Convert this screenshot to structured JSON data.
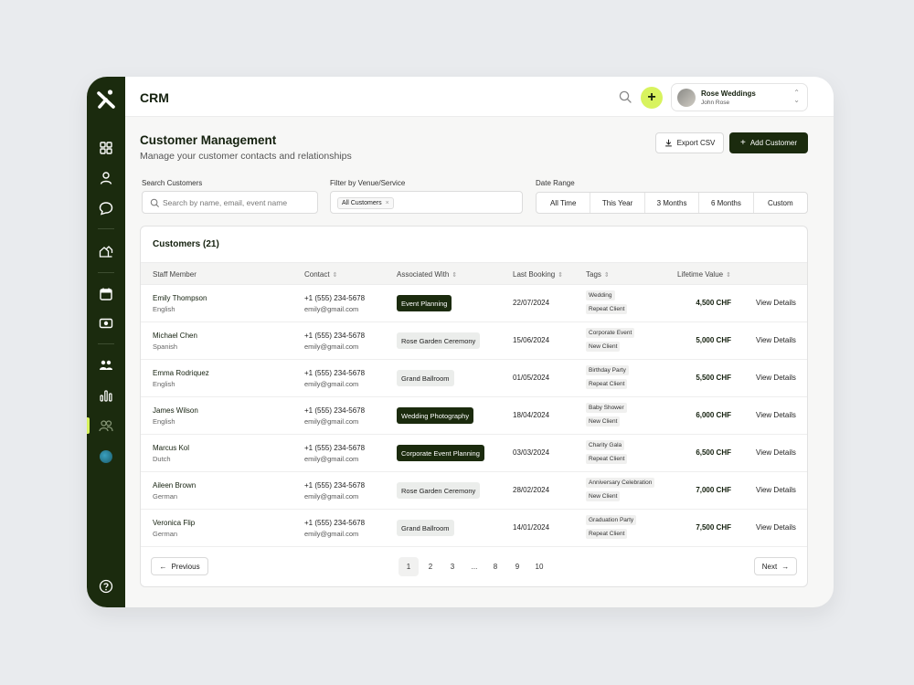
{
  "app": {
    "title": "CRM"
  },
  "user": {
    "name": "Rose Weddings",
    "subtitle": "John Rose"
  },
  "page": {
    "title": "Customer Management",
    "subtitle": "Manage your customer contacts and relationships"
  },
  "actions": {
    "export_label": "Export CSV",
    "add_label": "Add Customer"
  },
  "filters": {
    "search_label": "Search Customers",
    "search_placeholder": "Search by name, email, event name",
    "venue_label": "Filter by Venue/Service",
    "venue_chip": "All Customers",
    "date_label": "Date Range",
    "date_options": [
      "All Time",
      "This Year",
      "3 Months",
      "6 Months",
      "Custom"
    ]
  },
  "table": {
    "title": "Customers (21)",
    "headers": [
      "Staff Member",
      "Contact",
      "Associated With",
      "Last Booking",
      "Tags",
      "Lifetime Value"
    ],
    "view_label": "View Details",
    "rows": [
      {
        "name": "Emily Thompson",
        "lang": "English",
        "phone": "+1 (555) 234-5678",
        "email": "emily@gmail.com",
        "assoc": "Event Planning",
        "assoc_style": "dark",
        "date": "22/07/2024",
        "tags": [
          "Wedding",
          "Repeat Client"
        ],
        "value": "4,500 CHF"
      },
      {
        "name": "Michael Chen",
        "lang": "Spanish",
        "phone": "+1 (555) 234-5678",
        "email": "emily@gmail.com",
        "assoc": "Rose Garden Ceremony",
        "assoc_style": "light",
        "date": "15/06/2024",
        "tags": [
          "Corporate Event",
          "New Client"
        ],
        "value": "5,000 CHF"
      },
      {
        "name": "Emma Rodriquez",
        "lang": "English",
        "phone": "+1 (555) 234-5678",
        "email": "emily@gmail.com",
        "assoc": "Grand Ballroom",
        "assoc_style": "light",
        "date": "01/05/2024",
        "tags": [
          "Birthday Party",
          "Repeat Client"
        ],
        "value": "5,500 CHF"
      },
      {
        "name": "James Wilson",
        "lang": "English",
        "phone": "+1 (555) 234-5678",
        "email": "emily@gmail.com",
        "assoc": "Wedding Photography",
        "assoc_style": "dark",
        "date": "18/04/2024",
        "tags": [
          "Baby Shower",
          "New Client"
        ],
        "value": "6,000 CHF"
      },
      {
        "name": "Marcus Kol",
        "lang": "Dutch",
        "phone": "+1 (555) 234-5678",
        "email": "emily@gmail.com",
        "assoc": "Corporate Event Planning",
        "assoc_style": "dark",
        "date": "03/03/2024",
        "tags": [
          "Charity Gala",
          "Repeat Client"
        ],
        "value": "6,500 CHF"
      },
      {
        "name": "Aileen Brown",
        "lang": "German",
        "phone": "+1 (555) 234-5678",
        "email": "emily@gmail.com",
        "assoc": "Rose Garden Ceremony",
        "assoc_style": "light",
        "date": "28/02/2024",
        "tags": [
          "Anniversary Celebration",
          "New Client"
        ],
        "value": "7,000 CHF"
      },
      {
        "name": "Veronica Flip",
        "lang": "German",
        "phone": "+1 (555) 234-5678",
        "email": "emily@gmail.com",
        "assoc": "Grand Ballroom",
        "assoc_style": "light",
        "date": "14/01/2024",
        "tags": [
          "Graduation Party",
          "Repeat Client"
        ],
        "value": "7,500 CHF"
      }
    ]
  },
  "pagination": {
    "previous_label": "Previous",
    "next_label": "Next",
    "pages": [
      "1",
      "2",
      "3",
      "...",
      "8",
      "9",
      "10"
    ],
    "current": "1"
  },
  "colors": {
    "sidebar": "#1b2b0e",
    "accent": "#d8f35e",
    "primary_button": "#1b2b0e"
  },
  "icons": {
    "sidebar": [
      "logo-icon",
      "dashboard-icon",
      "user-icon",
      "chat-icon",
      "venue-icon",
      "calendar-icon",
      "payments-icon",
      "team-icon",
      "analytics-icon",
      "customers-icon",
      "globe-icon",
      "help-icon"
    ]
  }
}
